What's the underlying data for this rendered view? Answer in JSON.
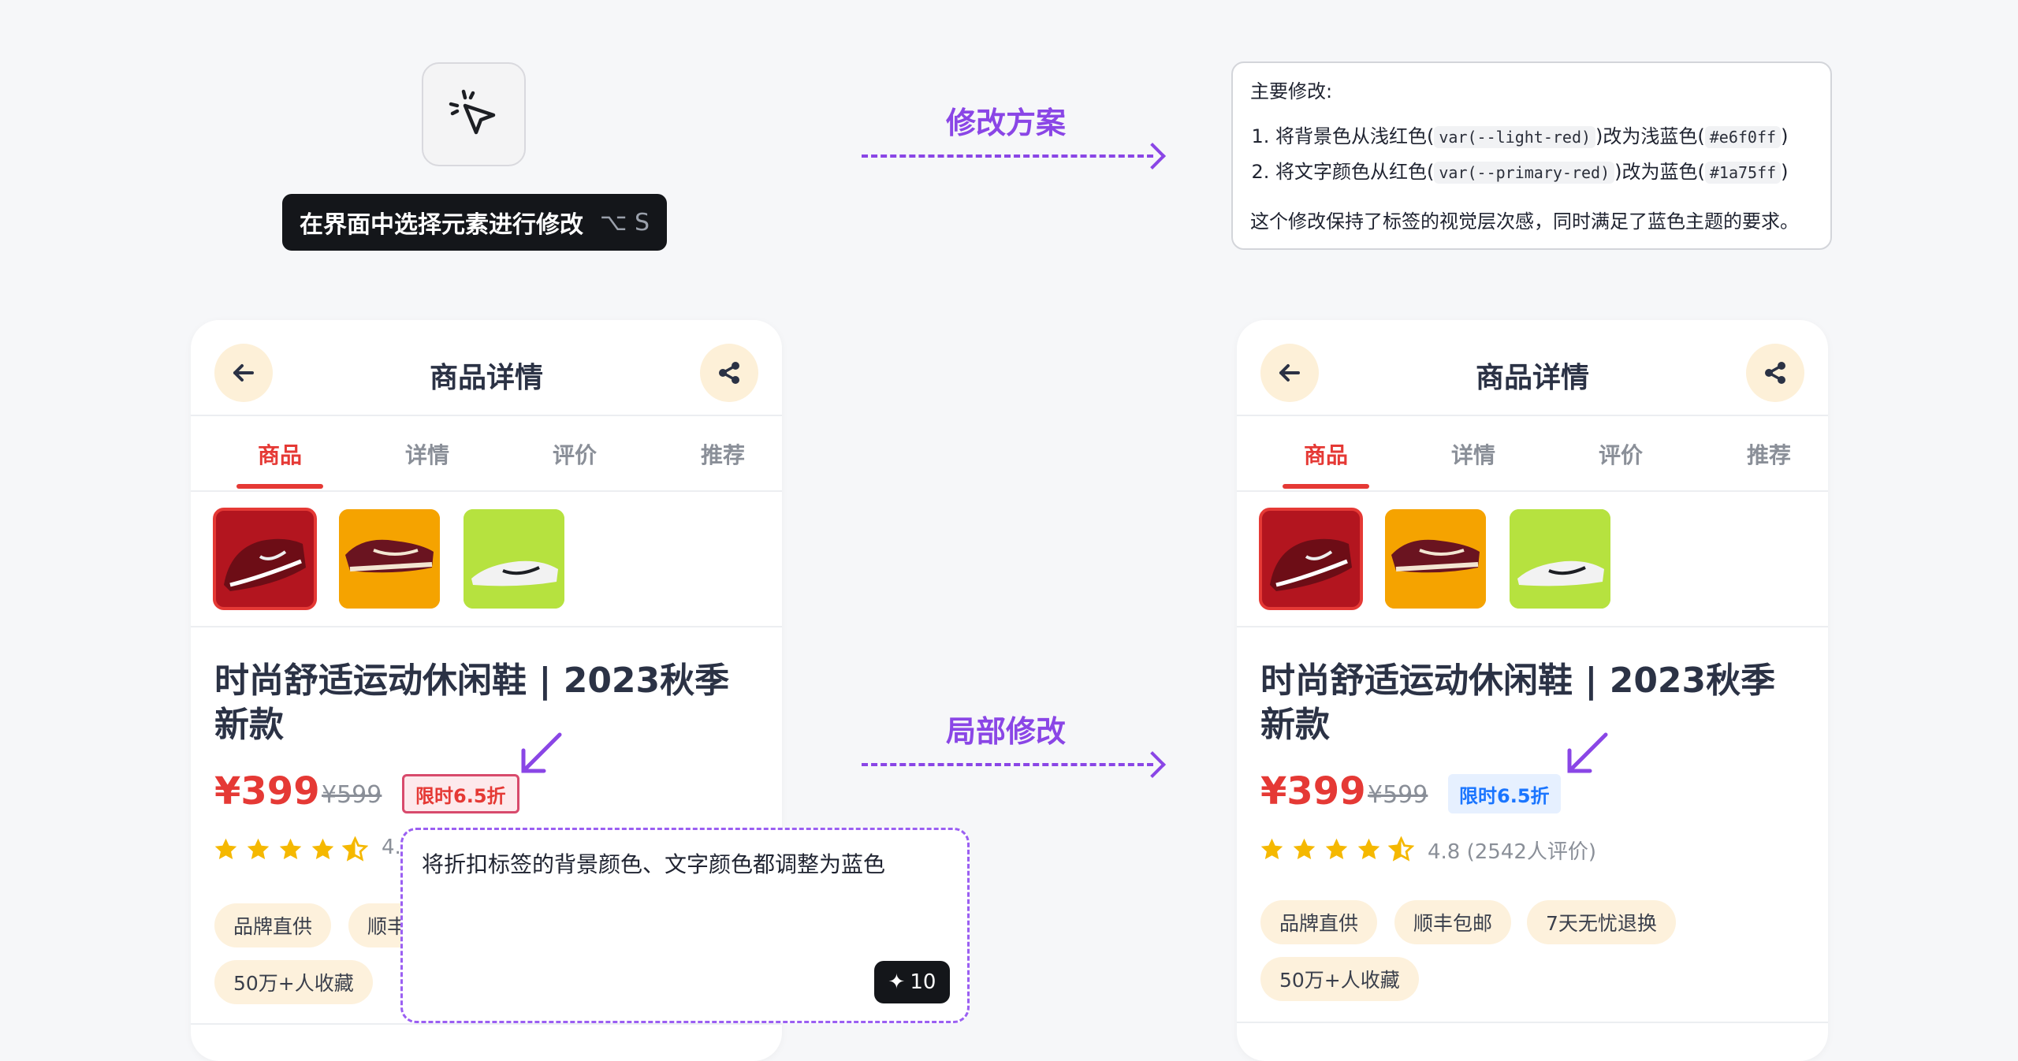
{
  "toolbar": {
    "select_label": "在界面中选择元素进行修改",
    "select_shortcut": "⌥ S"
  },
  "flows": {
    "plan_label": "修改方案",
    "local_label": "局部修改"
  },
  "plan": {
    "heading": "主要修改:",
    "items": [
      {
        "pre": "将背景色从浅红色(",
        "code1": "var(--light-red)",
        "mid": ")改为浅蓝色(",
        "code2": "#e6f0ff",
        "post": ")"
      },
      {
        "pre": "将文字颜色从红色(",
        "code1": "var(--primary-red)",
        "mid": ")改为蓝色(",
        "code2": "#1a75ff",
        "post": ")"
      }
    ],
    "summary": "这个修改保持了标签的视觉层次感，同时满足了蓝色主题的要求。"
  },
  "product": {
    "page_title": "商品详情",
    "tabs": [
      "商品",
      "详情",
      "评价",
      "推荐"
    ],
    "title": "时尚舒适运动休闲鞋 | 2023秋季新款",
    "price": "¥399",
    "old_price": "¥599",
    "discount": "限时6.5折",
    "rating_score": 4.8,
    "rating_text": "4.8 (2542人评价)",
    "rating_partial": "4.",
    "chips": [
      "品牌直供",
      "顺丰包邮",
      "7天无忧退换",
      "50万+人收藏"
    ],
    "chip_partial": "顺丰"
  },
  "prompt": {
    "text": "将折扣标签的背景颜色、文字颜色都调整为蓝色",
    "send_icon": "✦",
    "send_count": "10"
  },
  "colors": {
    "accent_purple": "#8a46e6",
    "primary_red": "#e53935",
    "light_red": "#fde9ec",
    "new_blue": "#1a75ff",
    "new_light_blue": "#e6f0ff",
    "chip_bg": "#fdf1dc",
    "star": "#f5b800"
  },
  "icons": {
    "cursor": "click-cursor-icon",
    "back": "arrow-left-icon",
    "share": "share-icon",
    "star": "star-icon",
    "send": "sparkle-icon",
    "pointer": "pointer-arrow-icon"
  }
}
